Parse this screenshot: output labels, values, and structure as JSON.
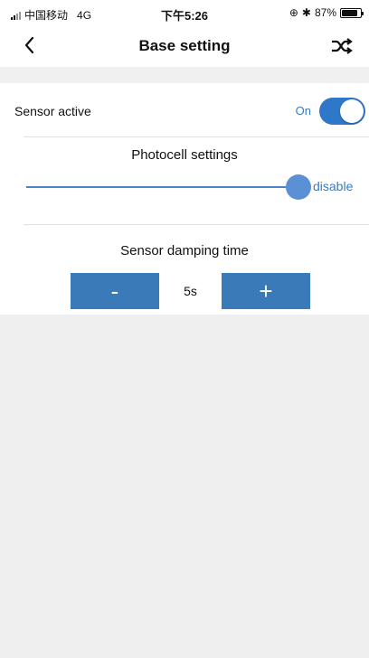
{
  "status": {
    "carrier": "中国移动",
    "network": "4G",
    "time": "下午5:26",
    "battery_percent": "87%",
    "battery_level": 0.87
  },
  "navbar": {
    "title": "Base setting",
    "back_icon": "chevron-left-icon",
    "action_icon": "shuffle-icon"
  },
  "sensor_active": {
    "label": "Sensor active",
    "state_label": "On",
    "enabled": true
  },
  "photocell": {
    "title": "Photocell settings",
    "value_label": "disable",
    "level": 1.0
  },
  "damping": {
    "title": "Sensor damping time",
    "minus_label": "-",
    "plus_label": "+",
    "value": "5s"
  },
  "colors": {
    "accent": "#2f77c9",
    "button": "#3a7ab8",
    "gray_bg": "#efefef"
  }
}
